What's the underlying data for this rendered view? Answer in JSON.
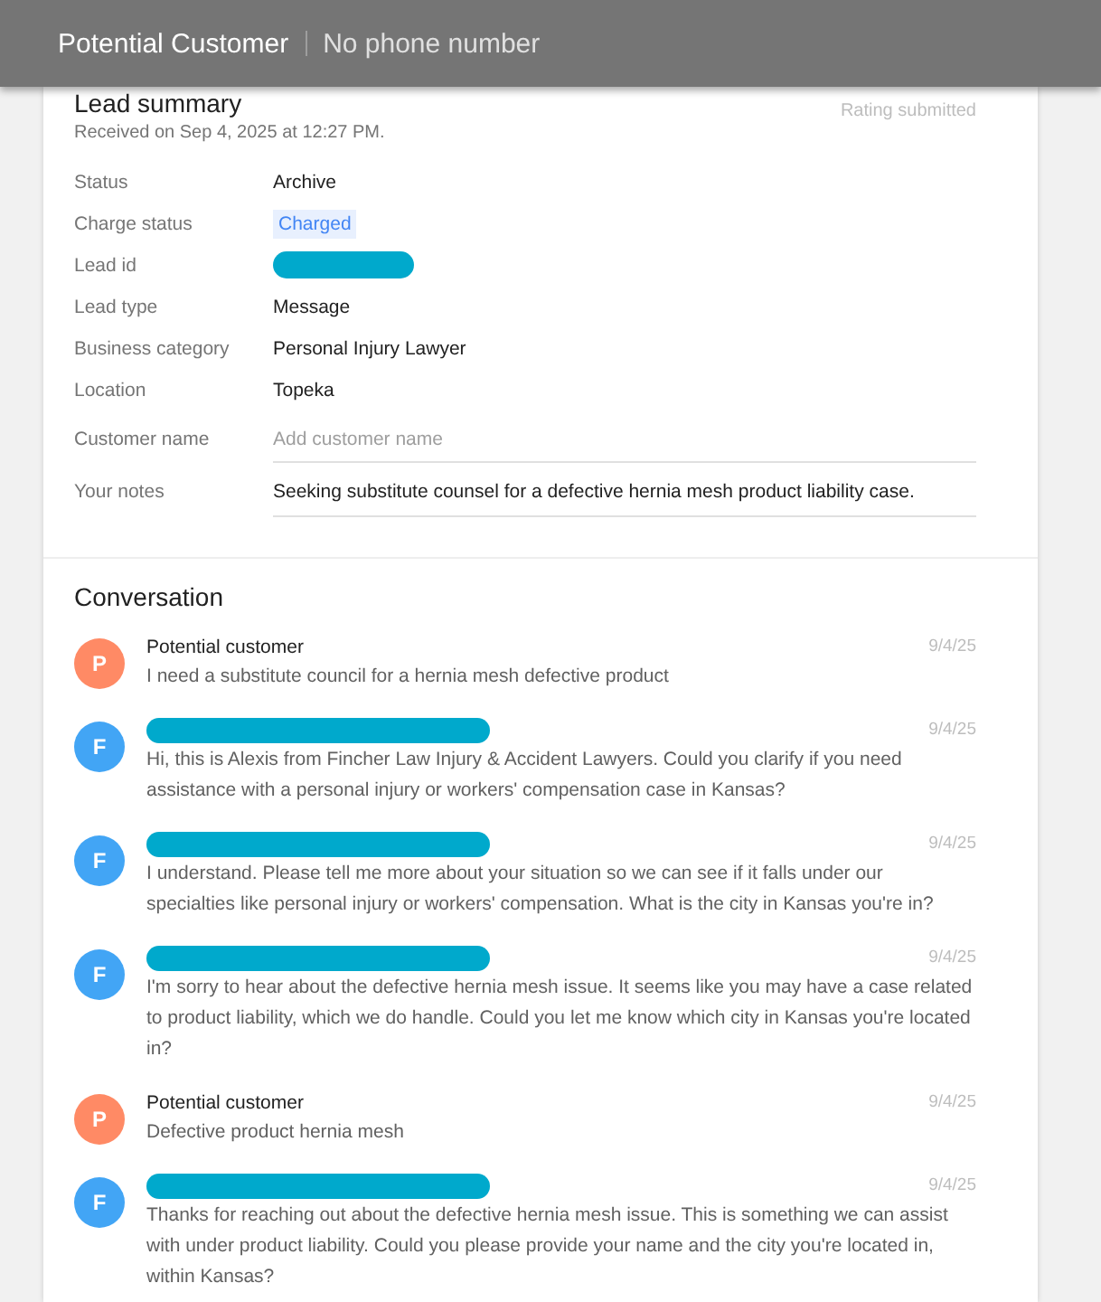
{
  "header": {
    "title": "Potential Customer",
    "subtitle": "No phone number"
  },
  "lead_summary": {
    "title": "Lead summary",
    "received": "Received on Sep 4, 2025 at 12:27 PM.",
    "rating_status": "Rating submitted",
    "fields": [
      {
        "label": "Status",
        "kind": "text",
        "value": "Archive"
      },
      {
        "label": "Charge status",
        "kind": "chip",
        "value": "Charged"
      },
      {
        "label": "Lead id",
        "kind": "redacted"
      },
      {
        "label": "Lead type",
        "kind": "text",
        "value": "Message"
      },
      {
        "label": "Business category",
        "kind": "text",
        "value": "Personal Injury Lawyer"
      },
      {
        "label": "Location",
        "kind": "text",
        "value": "Topeka"
      }
    ],
    "customer_name": {
      "label": "Customer name",
      "placeholder": "Add customer name"
    },
    "notes": {
      "label": "Your notes",
      "value": "Seeking substitute counsel for a defective hernia mesh product liability case."
    }
  },
  "conversation": {
    "title": "Conversation",
    "messages": [
      {
        "initial": "P",
        "color": "#ff8a65",
        "sender": "Potential customer",
        "sender_redacted": false,
        "date": "9/4/25",
        "text": "I need a substitute council for a hernia mesh defective product"
      },
      {
        "initial": "F",
        "color": "#42a5f5",
        "sender_redacted": true,
        "date": "9/4/25",
        "text": "Hi, this is Alexis from Fincher Law Injury & Accident Lawyers. Could you clarify if you need assistance with a personal injury or workers' compensation case in Kansas?"
      },
      {
        "initial": "F",
        "color": "#42a5f5",
        "sender_redacted": true,
        "date": "9/4/25",
        "text": "I understand. Please tell me more about your situation so we can see if it falls under our specialties like personal injury or workers' compensation. What is the city in Kansas you're in?"
      },
      {
        "initial": "F",
        "color": "#42a5f5",
        "sender_redacted": true,
        "date": "9/4/25",
        "text": "I'm sorry to hear about the defective hernia mesh issue. It seems like you may have a case related to product liability, which we do handle. Could you let me know which city in Kansas you're located in?"
      },
      {
        "initial": "P",
        "color": "#ff8a65",
        "sender": "Potential customer",
        "sender_redacted": false,
        "date": "9/4/25",
        "text": "Defective product hernia mesh"
      },
      {
        "initial": "F",
        "color": "#42a5f5",
        "sender_redacted": true,
        "date": "9/4/25",
        "text": "Thanks for reaching out about the defective hernia mesh issue. This is something we can assist with under product liability. Could you please provide your name and the city you're located in, within Kansas?"
      }
    ]
  }
}
